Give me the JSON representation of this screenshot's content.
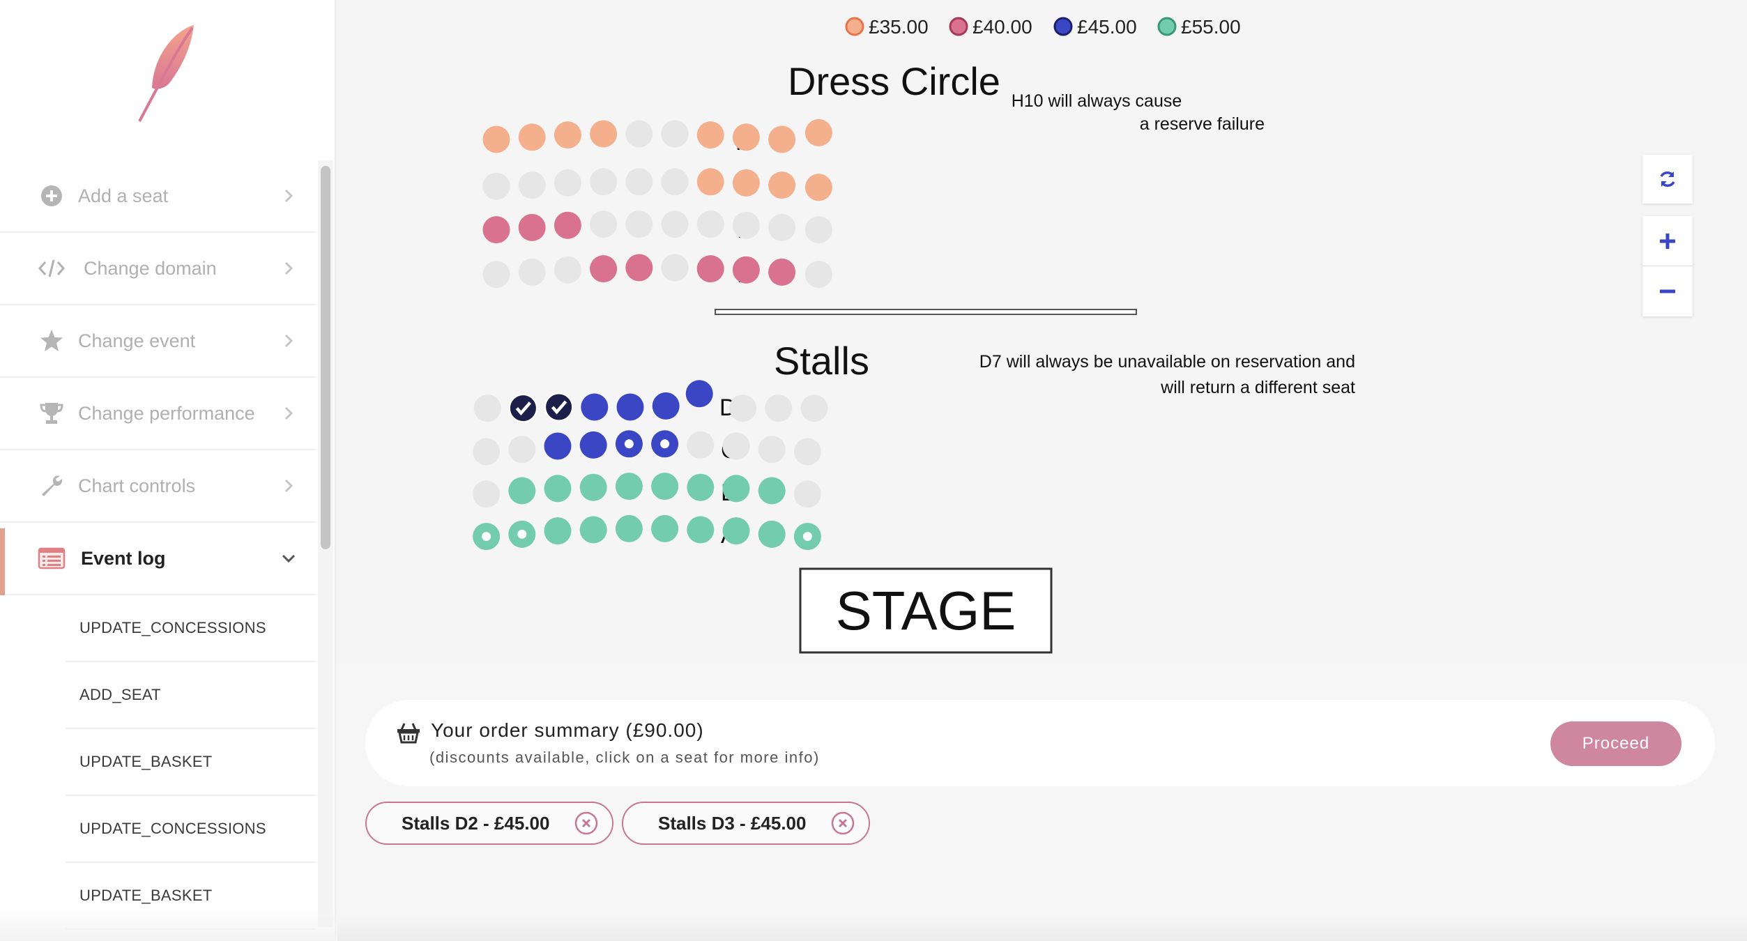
{
  "sidebar": {
    "items": [
      {
        "label": "Add a seat",
        "icon": "plus-circle-icon"
      },
      {
        "label": "Change domain",
        "icon": "code-icon"
      },
      {
        "label": "Change event",
        "icon": "star-icon"
      },
      {
        "label": "Change performance",
        "icon": "trophy-icon"
      },
      {
        "label": "Chart controls",
        "icon": "wrench-icon"
      },
      {
        "label": "Event log",
        "icon": "list-icon",
        "expanded": true
      }
    ],
    "event_log": [
      "UPDATE_CONCESSIONS",
      "ADD_SEAT",
      "UPDATE_BASKET",
      "UPDATE_CONCESSIONS",
      "UPDATE_BASKET"
    ]
  },
  "legend": [
    {
      "label": "£35.00",
      "color": "#f4b08d",
      "ring": "#e8734c"
    },
    {
      "label": "£40.00",
      "color": "#d9728f",
      "ring": "#a8375a"
    },
    {
      "label": "£45.00",
      "color": "#3b46c4",
      "ring": "#1a1f6b"
    },
    {
      "label": "£55.00",
      "color": "#72ccad",
      "ring": "#3b9677"
    }
  ],
  "seatmap": {
    "dress_circle_title": "Dress Circle",
    "stalls_title": "Stalls",
    "stage_label": "STAGE",
    "note_h10": [
      "H10 will always cause",
      "a reserve failure"
    ],
    "note_d7": [
      "D7 will always be unavailable on reservation and",
      "will return a different seat"
    ],
    "rows": {
      "H": [
        "35",
        "35",
        "35",
        "35",
        "x",
        "x",
        "35",
        "35",
        "35",
        "35"
      ],
      "G": [
        "x",
        "x",
        "x",
        "x",
        "x",
        "x",
        "35",
        "35",
        "35",
        "35"
      ],
      "F": [
        "40",
        "40",
        "40",
        "x",
        "x",
        "x",
        "x",
        "x",
        "x",
        "x"
      ],
      "E": [
        "x",
        "x",
        "x",
        "40",
        "40",
        "x",
        "40",
        "40",
        "40",
        "x"
      ],
      "D": [
        "x",
        "sel",
        "sel",
        "45",
        "45",
        "45",
        "45",
        "x",
        "x",
        "x"
      ],
      "C": [
        "x",
        "x",
        "45",
        "45",
        "45o",
        "45o",
        "x",
        "x",
        "x",
        "x"
      ],
      "B": [
        "x",
        "55",
        "55",
        "55",
        "55",
        "55",
        "55",
        "55",
        "55",
        "x"
      ],
      "A": [
        "55o",
        "55o",
        "55",
        "55",
        "55",
        "55",
        "55",
        "55",
        "55",
        "55o"
      ]
    },
    "colors": {
      "unavailable": "#e6e6e6",
      "selected": "#1c1f4a",
      "p35": "#f4b08d",
      "p40": "#d9728f",
      "p45": "#3b46c4",
      "p55": "#72ccad"
    }
  },
  "map_controls": {
    "refresh": "refresh-icon",
    "zoom_in": "plus-icon",
    "zoom_out": "minus-icon"
  },
  "order": {
    "title": "Your order summary (£90.00)",
    "subtitle": "(discounts available, click on a seat for more info)",
    "proceed_label": "Proceed",
    "items": [
      "Stalls D2 - £45.00",
      "Stalls D3 - £45.00"
    ]
  }
}
